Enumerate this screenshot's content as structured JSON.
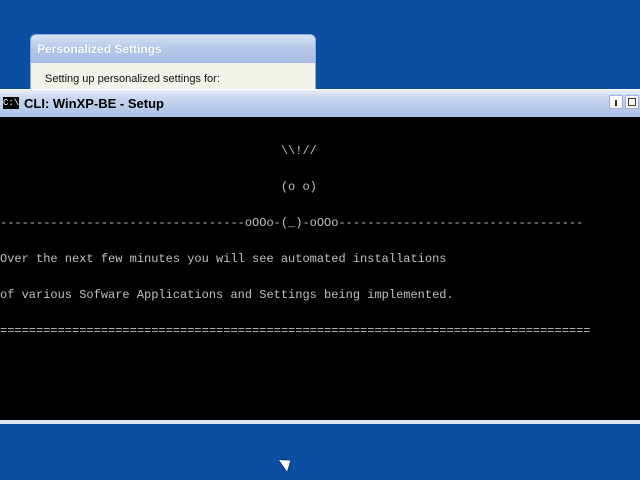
{
  "background_dialog": {
    "title": "Personalized Settings",
    "text": "Setting up personalized settings for:"
  },
  "console_window": {
    "icon": "C:\\",
    "title": "CLI: WinXP-BE - Setup",
    "lines": [
      "                                       \\\\!//",
      "                                       (o o)",
      "----------------------------------oOOo-(_)-oOOo----------------------------------",
      "Over the next few minutes you will see automated installations",
      "of various Sofware Applications and Settings being implemented.",
      "=================================================================================="
    ]
  },
  "colors": {
    "desktop_blue": "#0b4ea2",
    "console_bg": "#000000",
    "console_text": "#c0c0c0"
  },
  "icons": {
    "console": "console-icon",
    "minimize": "minimize-icon",
    "maximize": "maximize-icon",
    "cursor": "mouse-pointer-icon"
  }
}
